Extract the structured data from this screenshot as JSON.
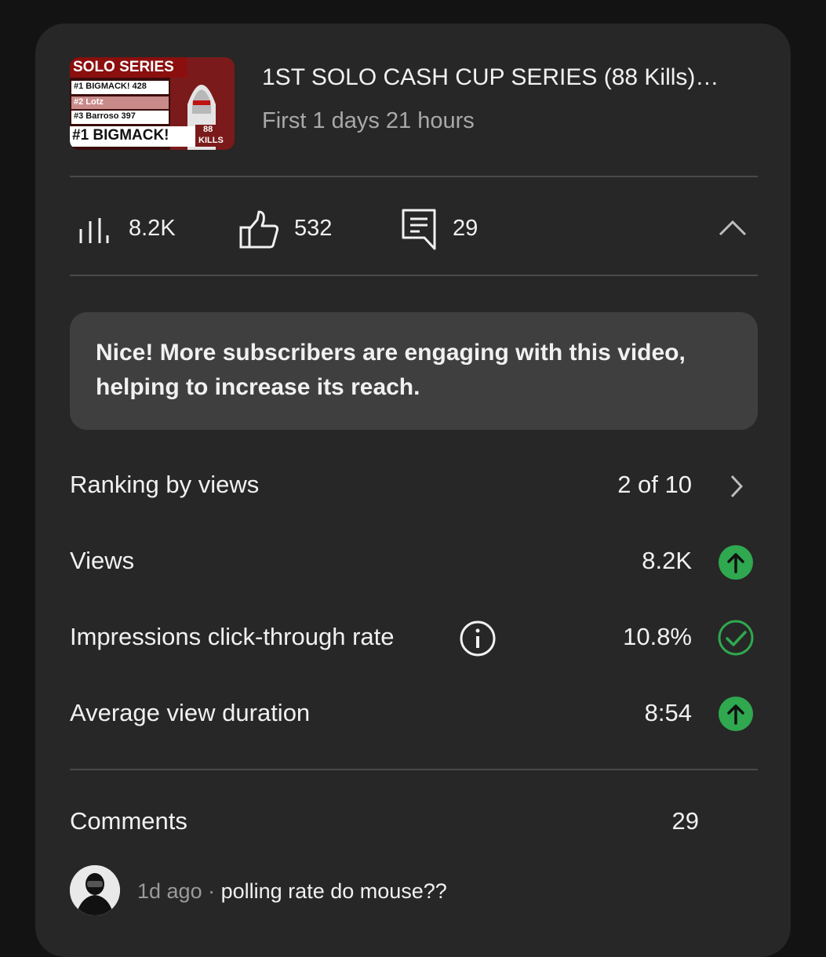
{
  "video": {
    "title": "1ST SOLO CASH CUP SERIES (88 Kills)…",
    "subtitle": "First 1 days 21 hours",
    "thumbnail_text": {
      "header": "SOLO SERIES",
      "row1": "#1 BIGMACK! 428",
      "row2": "#2 Lotz",
      "row3": "#3 Barroso 397",
      "footer": "#1 BIGMACK!",
      "badge_top": "88",
      "badge_bottom": "KILLS"
    }
  },
  "stats": {
    "views": "8.2K",
    "likes": "532",
    "comments": "29",
    "icons": [
      "bar-chart-icon",
      "thumbs-up-icon",
      "comment-icon",
      "chevron-up-icon"
    ]
  },
  "banner": {
    "text": "Nice! More subscribers are engaging with this video, helping to increase its reach."
  },
  "metrics": [
    {
      "label": "Ranking by views",
      "value": "2 of 10",
      "indicator": "chevron-right-icon"
    },
    {
      "label": "Views",
      "value": "8.2K",
      "indicator": "arrow-up-circle-icon"
    },
    {
      "label": "Impressions click-through rate",
      "value": "10.8%",
      "indicator": "check-circle-icon"
    },
    {
      "label": "Average view duration",
      "value": "8:54",
      "indicator": "arrow-up-circle-icon"
    }
  ],
  "comments_section": {
    "label": "Comments",
    "count": "29",
    "latest": {
      "time": "1d ago",
      "separator": "·",
      "text": "polling rate do mouse??"
    }
  },
  "colors": {
    "background": "#131313",
    "card": "#272727",
    "banner": "#3f3f3f",
    "positive": "#2fa84f",
    "secondary_text": "#a9a9a9"
  }
}
